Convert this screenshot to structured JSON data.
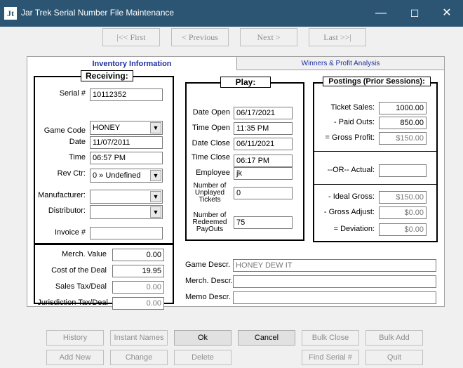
{
  "window": {
    "title": "Jar Trek Serial Number File Maintenance",
    "icon_text": "Jt",
    "controls": {
      "minimize": "—",
      "maximize": "☐",
      "close": "✕"
    }
  },
  "nav": {
    "first": "|<< First",
    "previous": "< Previous",
    "next": "Next >",
    "last": "Last >>|"
  },
  "tabs": [
    {
      "label": "Inventory Information"
    },
    {
      "label": "Winners & Profit Analysis"
    }
  ],
  "receiving": {
    "title": "Receiving:",
    "serial_label": "Serial #",
    "serial": "10112352",
    "game_code_label": "Game Code",
    "game_code": "HONEY",
    "date_label": "Date",
    "date": "11/07/2011",
    "time_label": "Time",
    "time": "06:57 PM",
    "rev_ctr_label": "Rev Ctr:",
    "rev_ctr": "0 » Undefined",
    "manufacturer_label": "Manufacturer:",
    "manufacturer": "",
    "distributor_label": "Distributor:",
    "distributor": "",
    "invoice_label": "Invoice #",
    "invoice": ""
  },
  "costs": {
    "merch_value_label": "Merch. Value",
    "merch_value": "0.00",
    "cost_label": "Cost of the Deal",
    "cost": "19.95",
    "sales_tax_label": "Sales Tax/Deal",
    "sales_tax": "0.00",
    "jur_tax_label": "Jurisdiction Tax/Deal",
    "jur_tax": "0.00"
  },
  "play": {
    "title": "Play:",
    "date_open_label": "Date Open",
    "date_open": "06/17/2021",
    "time_open_label": "Time Open",
    "time_open": "11:35 PM",
    "date_close_label": "Date Close",
    "date_close": "06/11/2021",
    "time_close_label": "Time Close",
    "time_close": "06:17 PM",
    "employee_label": "Employee",
    "employee": "jk",
    "unplayed_label_1": "Number of",
    "unplayed_label_2": "Unplayed",
    "unplayed_label_3": "Tickets",
    "unplayed": "0",
    "redeemed_label_1": "Number of",
    "redeemed_label_2": "Redeemed",
    "redeemed_label_3": "PayOuts",
    "redeemed": "75"
  },
  "postings": {
    "title": "Postings (Prior Sessions):",
    "ticket_sales_label": "Ticket Sales:",
    "ticket_sales": "1000.00",
    "paid_outs_label": "- Paid Outs:",
    "paid_outs": "850.00",
    "gross_profit_label": "= Gross Profit:",
    "gross_profit": "$150.00",
    "actual_label": "--OR-- Actual:",
    "actual": "",
    "ideal_gross_label": "- Ideal Gross:",
    "ideal_gross": "$150.00",
    "gross_adjust_label": "- Gross Adjust:",
    "gross_adjust": "$0.00",
    "deviation_label": "= Deviation:",
    "deviation": "$0.00"
  },
  "descr": {
    "game_label": "Game  Descr.",
    "game": "HONEY DEW IT",
    "merch_label": "Merch. Descr.",
    "merch": "",
    "memo_label": "Memo Descr.",
    "memo": ""
  },
  "buttons": {
    "history": "History",
    "instant_names": "Instant Names",
    "ok": "Ok",
    "cancel": "Cancel",
    "bulk_close": "Bulk Close",
    "bulk_add": "Bulk Add",
    "add_new": "Add New",
    "change": "Change",
    "delete": "Delete",
    "find_serial": "Find Serial #",
    "quit": "Quit"
  }
}
